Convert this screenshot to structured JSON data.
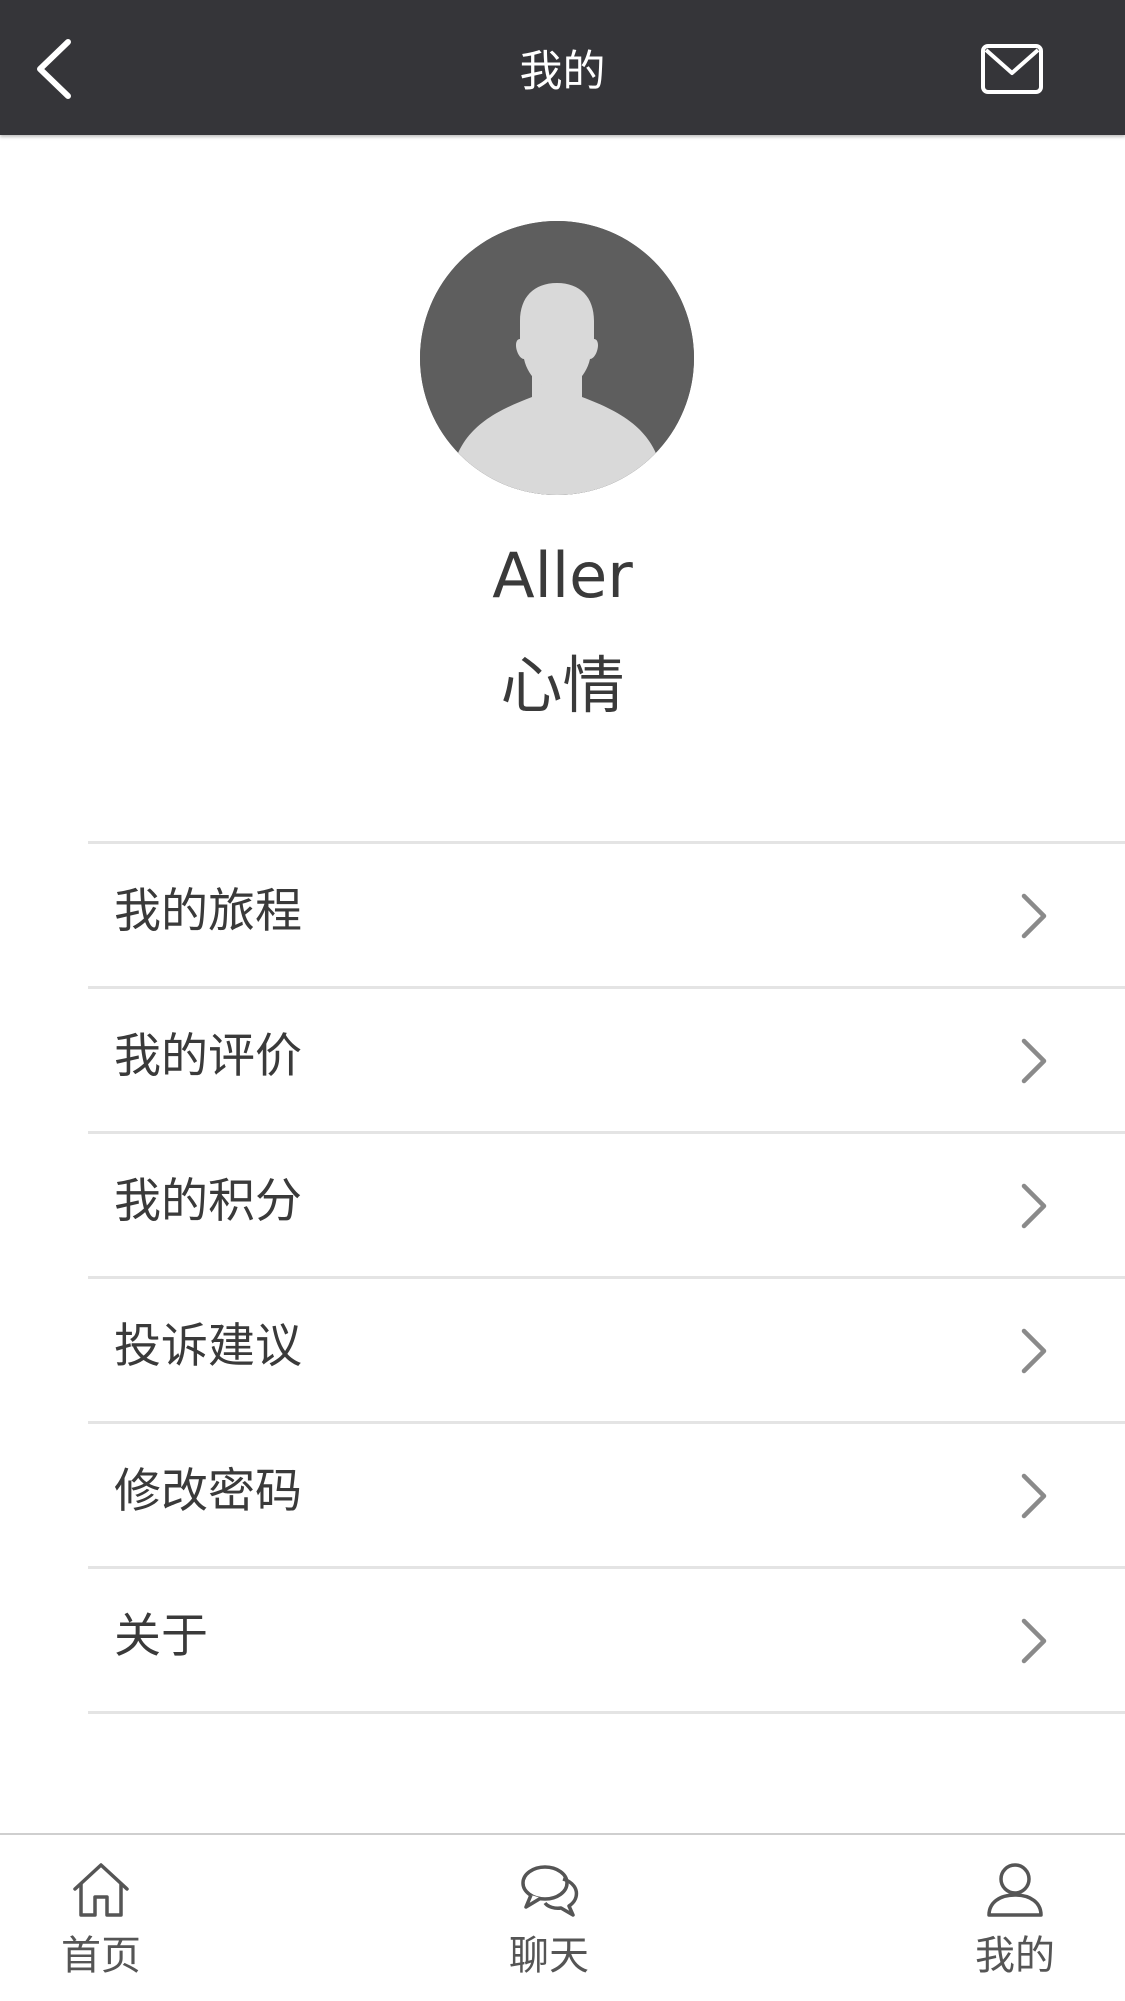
{
  "header": {
    "title": "我的",
    "back_icon": "chevron-left-icon",
    "mail_icon": "envelope-icon"
  },
  "profile": {
    "avatar_icon": "default-user-avatar",
    "username": "Aller",
    "mood": "心情"
  },
  "menu": {
    "items": [
      {
        "label": "我的旅程"
      },
      {
        "label": "我的评价"
      },
      {
        "label": "我的积分"
      },
      {
        "label": "投诉建议"
      },
      {
        "label": "修改密码"
      },
      {
        "label": "关于"
      }
    ],
    "chevron_icon": "chevron-right-icon"
  },
  "tabbar": {
    "tabs": [
      {
        "label": "首页",
        "icon": "home-icon"
      },
      {
        "label": "聊天",
        "icon": "chat-bubbles-icon"
      },
      {
        "label": "我的",
        "icon": "user-icon"
      }
    ]
  },
  "colors": {
    "header_bg": "#353539",
    "text": "#3a3a3a",
    "divider": "#e4e4e4",
    "chevron": "#8a8a8a",
    "avatar_bg": "#5e5e5e",
    "avatar_figure": "#d9d9d9"
  }
}
